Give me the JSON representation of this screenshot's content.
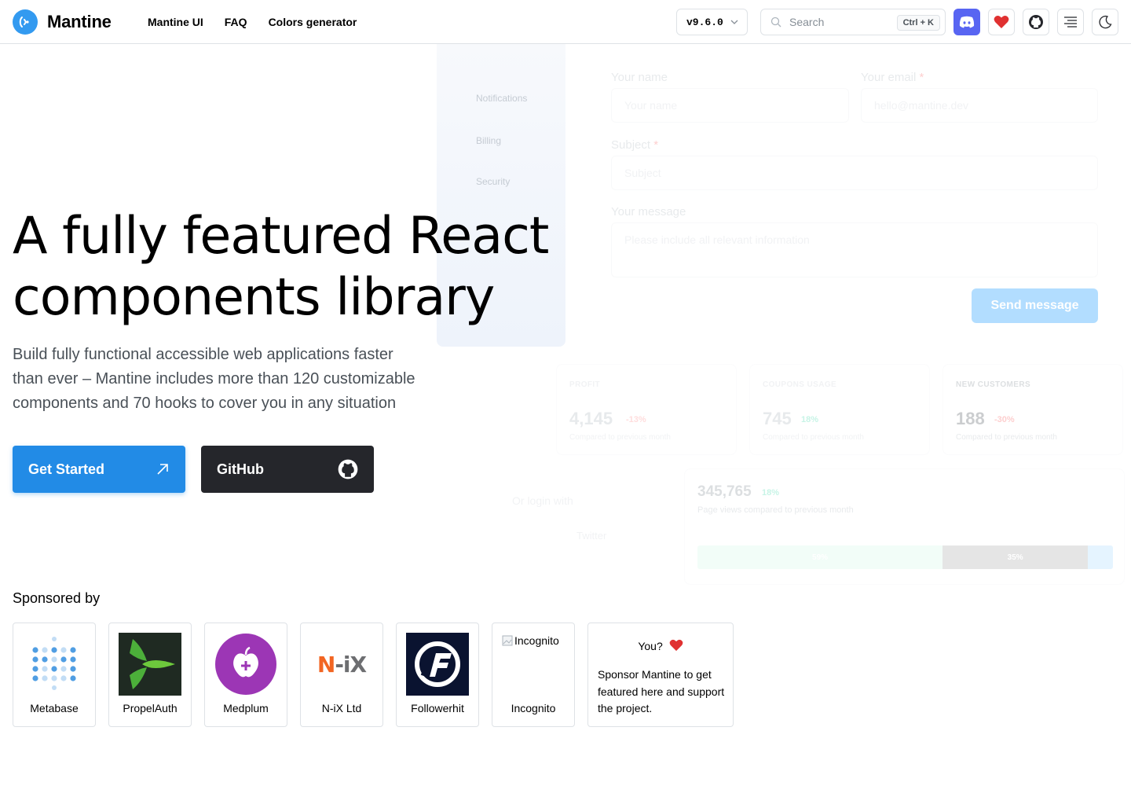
{
  "header": {
    "brand": "Mantine",
    "nav": [
      "Mantine UI",
      "FAQ",
      "Colors generator"
    ],
    "version": "v9.6.0",
    "search_placeholder": "Search",
    "search_shortcut": "Ctrl + K",
    "icon_buttons": [
      "discord-icon",
      "heart-icon",
      "github-icon",
      "menu-icon",
      "moon-icon"
    ]
  },
  "hero": {
    "title_line1": "A fully featured React",
    "title_line2": "components library",
    "description": "Build fully functional accessible web applications faster than ever – Mantine includes more than 120 customizable components and 70 hooks to cover you in any situation",
    "primary_button": "Get Started",
    "secondary_button": "GitHub"
  },
  "background_demo": {
    "left_panel_items": [
      "Notifications",
      "Billing",
      "Security"
    ],
    "form": {
      "name_label": "Your name",
      "name_placeholder": "Your name",
      "email_label": "Your email",
      "email_placeholder": "hello@mantine.dev",
      "subject_label": "Subject",
      "subject_placeholder": "Subject",
      "message_label": "Your message",
      "message_placeholder": "Please include all relevant information",
      "submit": "Send message"
    },
    "stats": [
      {
        "title": "PROFIT",
        "value": "4,145",
        "diff": "-13%",
        "caption": "Compared to previous month"
      },
      {
        "title": "COUPONS USAGE",
        "value": "745",
        "diff": "18%",
        "caption": "Compared to previous month"
      },
      {
        "title": "NEW CUSTOMERS",
        "value": "188",
        "diff": "-30%",
        "caption": "Compared to previous month"
      }
    ],
    "big_stat": {
      "value": "345,765",
      "diff": "18%",
      "caption": "Page views compared to previous month",
      "segments": [
        {
          "label": "59%",
          "fraction": 0.59,
          "color": "#d3f9e8"
        },
        {
          "label": "35%",
          "fraction": 0.35,
          "color": "#a6a6a6"
        },
        {
          "label": "",
          "fraction": 0.06,
          "color": "#a5d8ff"
        }
      ]
    },
    "login": {
      "text": "Or login with",
      "twitter": "Twitter"
    }
  },
  "sponsors": {
    "heading": "Sponsored by",
    "items": [
      {
        "name": "Metabase",
        "logo": "metabase-logo"
      },
      {
        "name": "PropelAuth",
        "logo": "propelauth-logo"
      },
      {
        "name": "Medplum",
        "logo": "medplum-logo"
      },
      {
        "name": "N-iX Ltd",
        "logo": "nix-logo",
        "logo_text": "N-iX"
      },
      {
        "name": "Followerhit",
        "logo": "followerhit-logo"
      },
      {
        "name": "Incognito",
        "logo": "broken-image-icon",
        "alt": "Incognito"
      }
    ],
    "you": {
      "title": "You?",
      "description": "Sponsor Mantine to get featured here and support the project."
    }
  },
  "colors": {
    "primary": "#228be6",
    "dark_button": "#25262b",
    "discord": "#5865f2",
    "heart": "#fa5252"
  }
}
